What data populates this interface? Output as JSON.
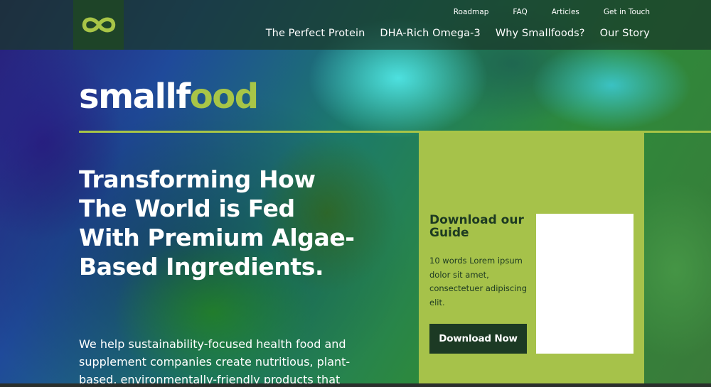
{
  "brand": {
    "wordmark_part1": "smallf",
    "wordmark_part2": "oo",
    "wordmark_part3": "d",
    "accent_color": "#a8c547",
    "logo_icon": "infinity-loop-icon"
  },
  "utility_nav": [
    {
      "label": "Roadmap"
    },
    {
      "label": "FAQ"
    },
    {
      "label": "Articles"
    },
    {
      "label": "Get in Touch"
    }
  ],
  "main_nav": [
    {
      "label": "The Perfect Protein"
    },
    {
      "label": "DHA-Rich Omega-3"
    },
    {
      "label": "Why Smallfoods?"
    },
    {
      "label": "Our Story"
    }
  ],
  "hero": {
    "headline": "Transforming How The World is Fed With Premium Algae-Based Ingredients.",
    "lead": "We help sustainability-focused health food and supplement companies create nutritious, plant-based, environmentally-friendly products that"
  },
  "guide": {
    "title": "Download our Guide",
    "description": "10 words Lorem ipsum dolor sit amet, consectetuer adipiscing elit.",
    "button_label": "Download Now",
    "panel_color": "#a6c24a",
    "button_color": "#1c3a24"
  }
}
